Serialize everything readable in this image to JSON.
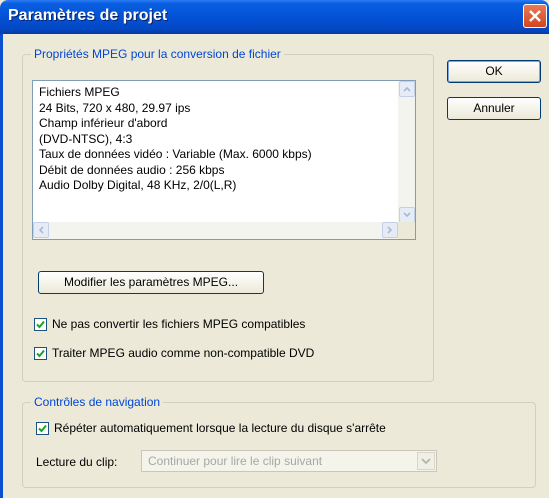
{
  "window": {
    "title": "Paramètres de projet"
  },
  "mpeg_group": {
    "legend": "Propriétés MPEG pour la conversion de fichier",
    "lines": [
      "Fichiers MPEG",
      "24 Bits, 720 x 480, 29.97 ips",
      "Champ inférieur d'abord",
      "(DVD-NTSC),  4:3",
      "Taux de données vidéo : Variable  (Max.  6000 kbps)",
      "Débit de données audio : 256 kbps",
      "Audio Dolby Digital, 48 KHz, 2/0(L,R)"
    ],
    "modify_button": "Modifier les paramètres MPEG...",
    "checkbox_no_convert": {
      "label": "Ne pas convertir les fichiers MPEG compatibles",
      "checked": true
    },
    "checkbox_audio_incompatible": {
      "label": "Traiter MPEG audio comme non-compatible DVD",
      "checked": true
    }
  },
  "buttons": {
    "ok": "OK",
    "cancel": "Annuler"
  },
  "nav_group": {
    "legend": "Contrôles de navigation",
    "checkbox_repeat": {
      "label": "Répéter automatiquement lorsque la lecture du disque s'arrête",
      "checked": true
    },
    "clip_label": "Lecture du clip:",
    "clip_value": "Continuer pour lire le clip suivant"
  },
  "colors": {
    "title_bar": "#0352d6",
    "legend_text": "#0046d5",
    "dialog_bg": "#ece9d8"
  }
}
